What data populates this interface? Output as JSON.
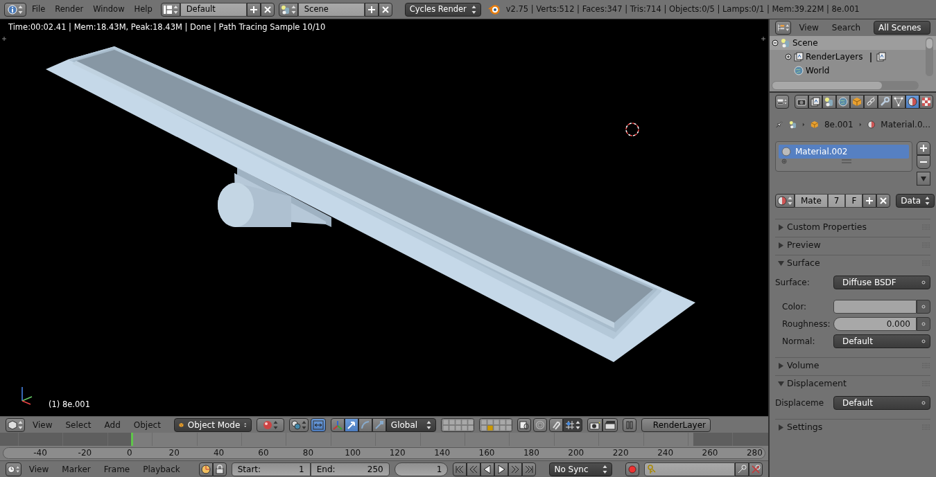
{
  "top_bar": {
    "menus": [
      "File",
      "Render",
      "Window",
      "Help"
    ],
    "layout": "Default",
    "scene": "Scene",
    "engine": "Cycles Render",
    "stats": "v2.75 | Verts:512 | Faces:347 | Tris:714 | Objects:0/5 | Lamps:0/1 | Mem:39.22M | 8e.001"
  },
  "viewport": {
    "render_info": "Time:00:02.41 | Mem:18.43M, Peak:18.43M | Done | Path Tracing Sample 10/10",
    "object_label": "(1) 8e.001"
  },
  "viewport_header": {
    "menus": [
      "View",
      "Select",
      "Add",
      "Object"
    ],
    "mode": "Object Mode",
    "manipulators": [
      {
        "kind": "translate",
        "selected": true
      },
      {
        "kind": "rotate",
        "selected": false
      },
      {
        "kind": "scale",
        "selected": false
      }
    ],
    "orientation": "Global",
    "render_layer": "RenderLayer"
  },
  "timeline": {
    "ruler_labels": [
      "-40",
      "-20",
      "0",
      "20",
      "40",
      "60",
      "80",
      "100",
      "120",
      "140",
      "160",
      "180",
      "200",
      "220",
      "240",
      "260",
      "280"
    ]
  },
  "timeline_header": {
    "menus": [
      "View",
      "Marker",
      "Frame",
      "Playback"
    ],
    "start_label": "Start:",
    "start": "1",
    "end_label": "End:",
    "end": "250",
    "current": "1",
    "sync": "No Sync"
  },
  "outliner": {
    "menus": [
      "View",
      "Search"
    ],
    "filter": "All Scenes",
    "tree": [
      {
        "label": "Scene",
        "kind": "scene",
        "selected": true,
        "expanded": true,
        "children": [
          {
            "label": "RenderLayers",
            "kind": "layers",
            "selected": false,
            "expanded": false
          },
          {
            "label": "World",
            "kind": "world",
            "selected": false
          }
        ]
      }
    ]
  },
  "properties": {
    "tabs": [
      {
        "kind": "render",
        "selected": false
      },
      {
        "kind": "layers",
        "selected": false
      },
      {
        "kind": "scene",
        "selected": false
      },
      {
        "kind": "world",
        "selected": false
      },
      {
        "kind": "object",
        "selected": false
      },
      {
        "kind": "constraints",
        "selected": false
      },
      {
        "kind": "modifiers",
        "selected": false
      },
      {
        "kind": "data",
        "selected": false
      },
      {
        "kind": "material",
        "selected": true
      },
      {
        "kind": "texture",
        "selected": false
      }
    ],
    "breadcrumb": [
      "8e.001",
      "Material.0..."
    ],
    "material_slots": [
      {
        "label": "Material.002",
        "selected": true
      }
    ],
    "datablock": {
      "name": "Mate",
      "users": "7",
      "fake": "F",
      "link": "Data"
    },
    "panels": [
      {
        "title": "Custom Properties",
        "expanded": false
      },
      {
        "title": "Preview",
        "expanded": false
      },
      {
        "title": "Surface",
        "expanded": true,
        "fields": [
          {
            "kind": "dropdown",
            "label": "Surface:",
            "value": "Diffuse BSDF"
          },
          {
            "kind": "color",
            "label": "Color:"
          },
          {
            "kind": "slider",
            "label": "Roughness:",
            "value": "0.000"
          },
          {
            "kind": "dropdown",
            "label": "Normal:",
            "value": "Default"
          }
        ]
      },
      {
        "title": "Volume",
        "expanded": false
      },
      {
        "title": "Displacement",
        "expanded": true,
        "fields": [
          {
            "kind": "dropdown",
            "label": "Displaceme",
            "value": "Default"
          }
        ]
      },
      {
        "title": "Settings",
        "expanded": false
      }
    ]
  }
}
